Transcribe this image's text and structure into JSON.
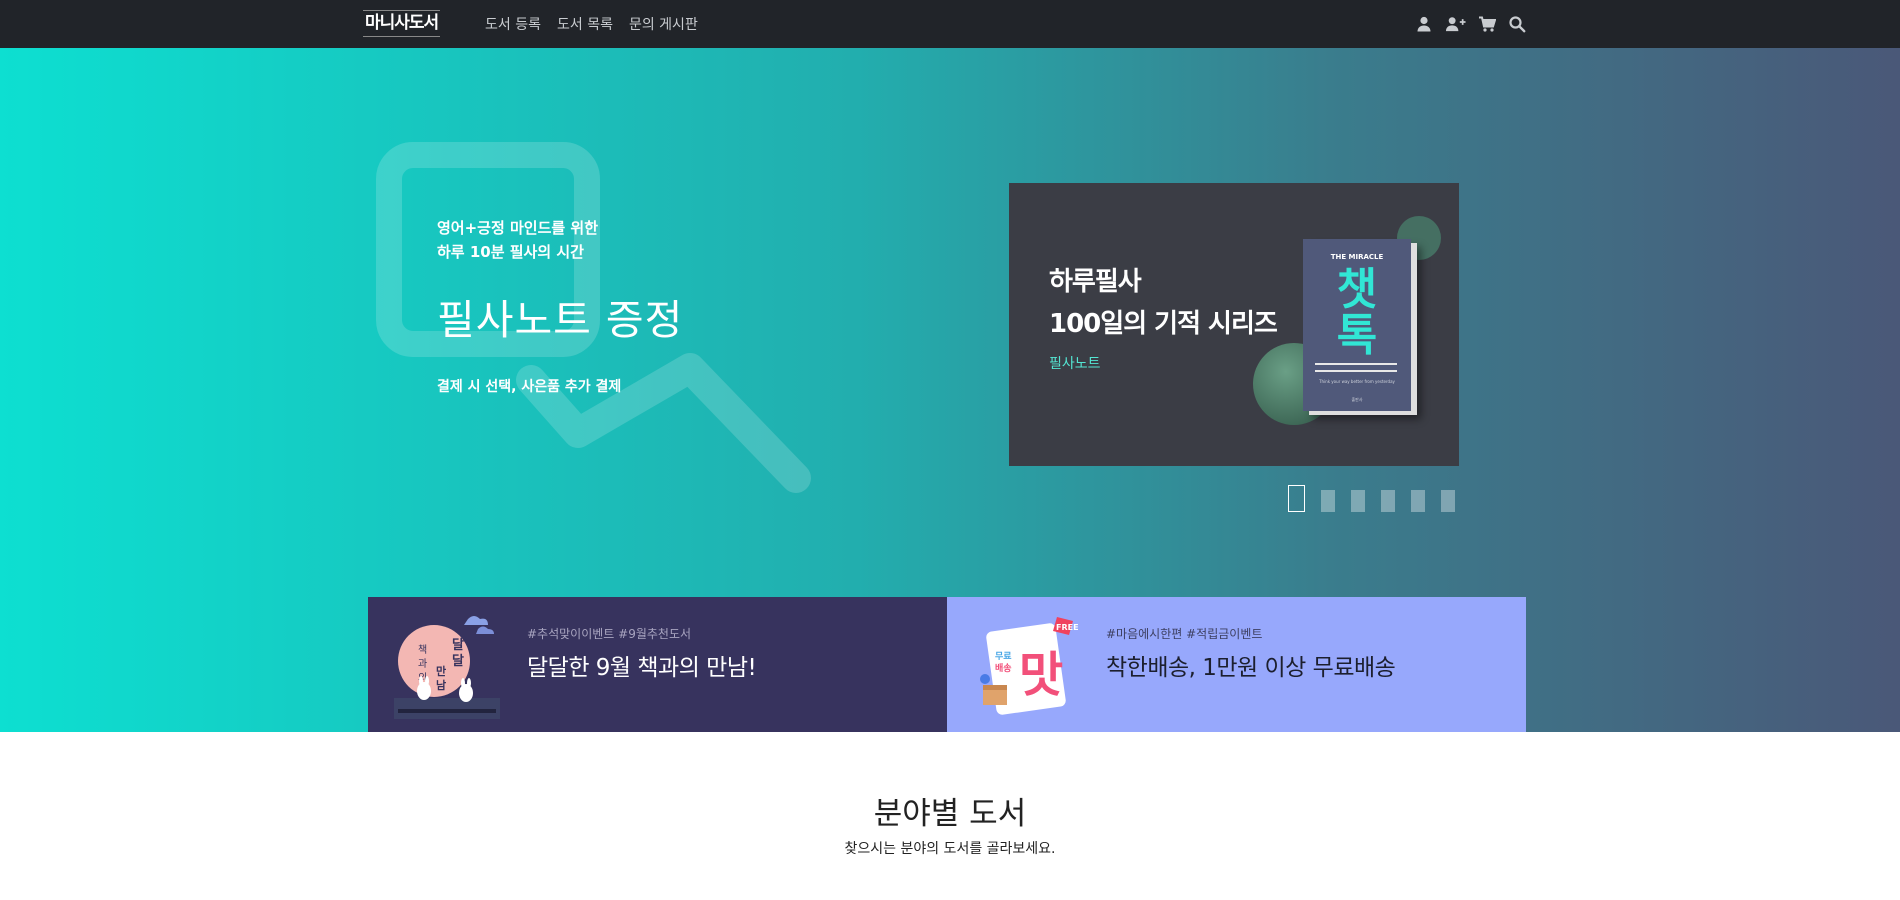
{
  "header": {
    "logo_text": "마니사도서",
    "nav": [
      "도서 등록",
      "도서 목록",
      "문의 게시판"
    ],
    "icons": [
      "user-icon",
      "user-plus-icon",
      "cart-icon",
      "search-icon"
    ]
  },
  "hero": {
    "subtitle_line1": "영어+긍정 마인드를 위한",
    "subtitle_line2": "하루 10분 필사의 시간",
    "title": "필사노트 증정",
    "note": "결제 시 선택, 사은품 추가 결제",
    "slide": {
      "line1": "하루필사",
      "line2": "100일의 기적 시리즈",
      "tag": "필사노트",
      "book_series": "THE MIRACLE",
      "book_title": "챗톡",
      "book_subtitle": "Think your way better from yesterday",
      "book_publisher": "출판사"
    },
    "slide_count": 6,
    "active_slide": 1
  },
  "promos": [
    {
      "thumb_text": "달달한 책과의 만남",
      "tags": "#추석맞이이벤트 #9월추천도서",
      "title": "달달한 9월 책과의 만남!"
    },
    {
      "thumb_badge": "FREE",
      "thumb_text": "맛",
      "tags": "#마음에시한편 #적립금이벤트",
      "title": "착한배송, 1만원 이상 무료배송"
    }
  ],
  "section": {
    "title": "분야별 도서",
    "subtitle": "찾으시는 분야의 도서를 골라보세요."
  },
  "colors": {
    "navbar": "#212429",
    "hero_start": "#0ddfd1",
    "hero_end": "#4a5878",
    "promo_left": "#37335e",
    "promo_right": "#97a8fc",
    "accent_teal": "#31e6d5"
  }
}
